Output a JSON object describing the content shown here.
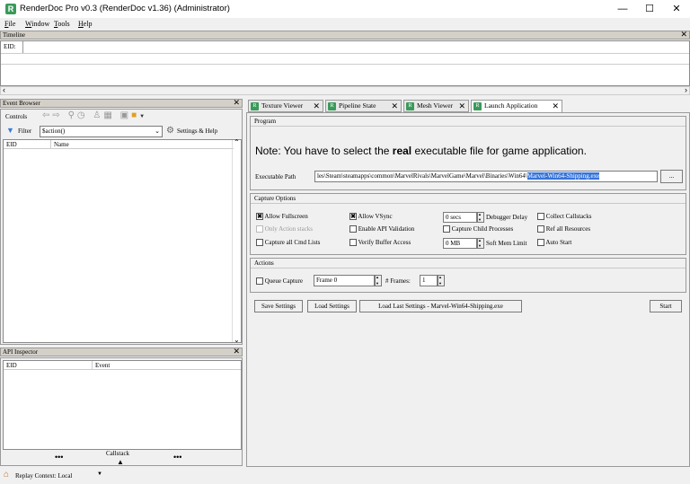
{
  "window": {
    "title": "RenderDoc Pro v0.3 (RenderDoc v1.36) (Administrator)",
    "app_icon": "renderdoc-icon",
    "minimize": "—",
    "maximize": "☐",
    "close": "✕"
  },
  "menu": [
    {
      "key": "F",
      "rest": "ile"
    },
    {
      "key": "W",
      "rest": "indow"
    },
    {
      "key": "T",
      "rest": "ools"
    },
    {
      "key": "H",
      "rest": "elp"
    }
  ],
  "timeline": {
    "title": "Timeline",
    "eid_label": "EID:"
  },
  "event_browser": {
    "title": "Event Browser",
    "controls_label": "Controls",
    "filter_label": "Filter",
    "filter_value": "$action()",
    "settings_label": "Settings & Help",
    "columns": [
      "EID",
      "Name"
    ]
  },
  "api_inspector": {
    "title": "API Inspector",
    "columns": [
      "EID",
      "Event"
    ],
    "callstack_label": "Callstack",
    "dots": "•••"
  },
  "tabs": [
    {
      "label": "Texture Viewer"
    },
    {
      "label": "Pipeline State"
    },
    {
      "label": "Mesh Viewer"
    },
    {
      "label": "Launch Application"
    }
  ],
  "program": {
    "title": "Program",
    "note_prefix": "Note: You have to select the ",
    "note_bold": "real",
    "note_suffix": " executable file for game application.",
    "exe_label": "Executable Path",
    "exe_path_plain": "les\\Steam\\steamapps\\common\\MarvelRivals\\MarvelGame\\Marvel\\Binaries\\Win64\\",
    "exe_path_selected": "Marvel-Win64-Shipping.exe",
    "browse_label": "..."
  },
  "capture_options": {
    "title": "Capture Options",
    "allow_fullscreen": "Allow Fullscreen",
    "allow_vsync": "Allow VSync",
    "debugger_delay_value": "0 secs",
    "debugger_delay_label": "Debugger Delay",
    "collect_callstacks": "Collect Callstacks",
    "only_action_stacks": "Only Action stacks",
    "enable_api_validation": "Enable API Validation",
    "capture_child_processes": "Capture Child Processes",
    "ref_all_resources": "Ref all Resources",
    "capture_all_cmd_lists": "Capture all Cmd Lists",
    "verify_buffer_access": "Verify Buffer Access",
    "soft_mem_limit_value": "0 MB",
    "soft_mem_limit_label": "Soft Mem Limit",
    "auto_start": "Auto Start"
  },
  "actions": {
    "title": "Actions",
    "queue_capture": "Queue Capture",
    "frame_value": "Frame 0",
    "frames_label": "# Frames:",
    "frames_value": "1"
  },
  "buttons": {
    "save_settings": "Save Settings",
    "load_settings": "Load Settings",
    "load_last": "Load Last Settings - Marvel-Win64-Shipping.exe",
    "start": "Start"
  },
  "status": {
    "replay_context": "Replay Context: Local",
    "dropdown_arrow": "▼"
  },
  "colors": {
    "accent": "#3a9a5a",
    "selection": "#3874d8"
  }
}
